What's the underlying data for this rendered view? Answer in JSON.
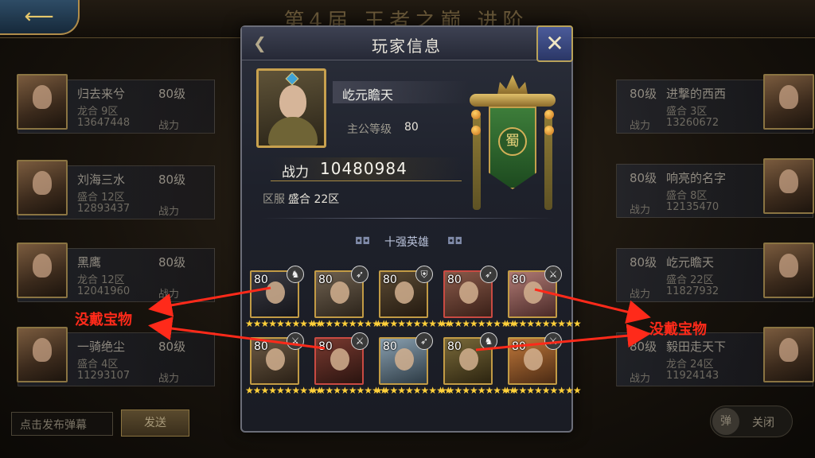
{
  "background": {
    "title": "第4届 王者之巅 进阶",
    "left_players": [
      {
        "name": "归去来兮",
        "level": "80级",
        "server": "龙合 9区",
        "power": "13647448",
        "power_label": "战力"
      },
      {
        "name": "刘海三水",
        "level": "80级",
        "server": "盛合 12区",
        "power": "12893437",
        "power_label": "战力"
      },
      {
        "name": "黑鹰",
        "level": "80级",
        "server": "龙合 12区",
        "power": "12041960",
        "power_label": "战力"
      },
      {
        "name": "一骑绝尘",
        "level": "80级",
        "server": "盛合 4区",
        "power": "11293107",
        "power_label": "战力"
      }
    ],
    "right_players": [
      {
        "name": "进撃的西西",
        "level": "80级",
        "server": "盛合 3区",
        "power": "13260672",
        "power_label": "战力"
      },
      {
        "name": "响亮的名字",
        "level": "80级",
        "server": "盛合 8区",
        "power": "12135470",
        "power_label": "战力"
      },
      {
        "name": "屹元瞻天",
        "level": "80级",
        "server": "盛合 22区",
        "power": "11827932",
        "power_label": "战力"
      },
      {
        "name": "毅田走天下",
        "level": "80级",
        "server": "龙合 24区",
        "power": "11924143",
        "power_label": "战力"
      }
    ],
    "danmaku_placeholder": "点击发布弹幕",
    "send_label": "发送",
    "toggle_knob": "弹",
    "toggle_label": "关闭"
  },
  "modal": {
    "title": "玩家信息",
    "close_icon": "close-x-icon",
    "player_name": "屹元瞻天",
    "lord_level_label": "主公等级",
    "lord_level_value": "80",
    "power_label": "战力",
    "power_value": "10480984",
    "server_label": "区服",
    "server_value": "盛合 22区",
    "faction_emblem": "蜀",
    "section_title": "十强英雄",
    "heroes": [
      {
        "level": "80",
        "weapon": "horse",
        "stars": "★★★★★★★★★★",
        "frame": "gold"
      },
      {
        "level": "80",
        "weapon": "bow",
        "stars": "★★★★★★★★★★",
        "frame": "gold"
      },
      {
        "level": "80",
        "weapon": "shield",
        "stars": "★★★★★★★★★★",
        "frame": "gold"
      },
      {
        "level": "80",
        "weapon": "bow",
        "stars": "★★★★★★★★★★",
        "frame": "red"
      },
      {
        "level": "80",
        "weapon": "sword",
        "stars": "★★★★★★★★★★",
        "frame": "gold"
      },
      {
        "level": "80",
        "weapon": "sword",
        "stars": "★★★★★★★★★★",
        "frame": "gold"
      },
      {
        "level": "80",
        "weapon": "sword",
        "stars": "★★★★★★★★★★",
        "frame": "red"
      },
      {
        "level": "80",
        "weapon": "bow",
        "stars": "★★★★★★★★★★",
        "frame": "gold"
      },
      {
        "level": "80",
        "weapon": "horse",
        "stars": "★★★★★★★★★★",
        "frame": "gold"
      },
      {
        "level": "80",
        "weapon": "sword",
        "stars": "★★★★★★★★★★",
        "frame": "gold"
      }
    ]
  },
  "annotations": {
    "left_label": "没戴宝物",
    "right_label": "没戴宝物",
    "color": "#ff2a1a"
  }
}
